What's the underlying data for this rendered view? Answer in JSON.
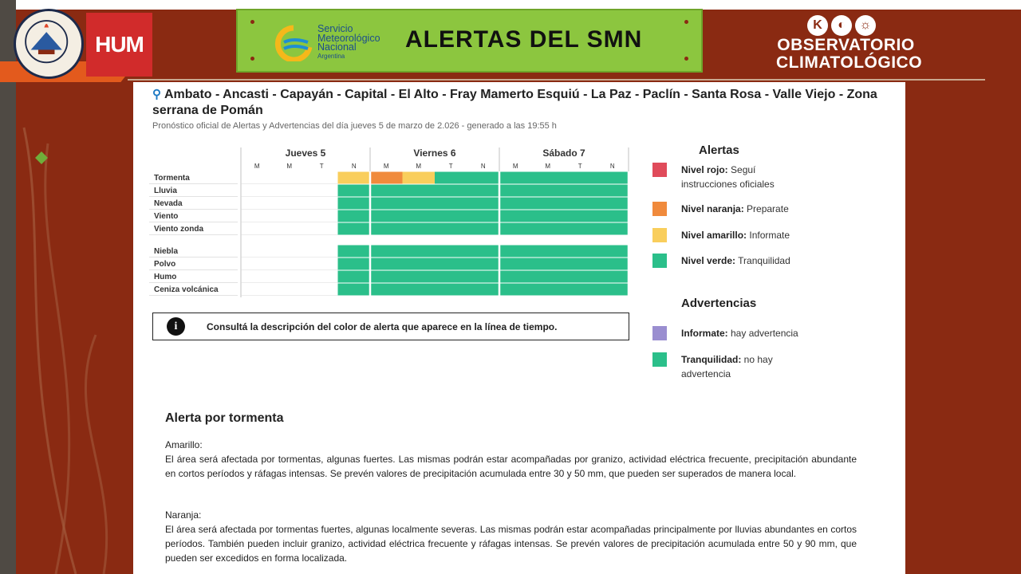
{
  "header": {
    "hum_label": "HUM",
    "smn_name_line1": "Servicio",
    "smn_name_line2": "Meteorológico",
    "smn_name_line3": "Nacional",
    "smn_name_line4": "Argentina",
    "title": "ALERTAS DEL SMN",
    "observatorio_line1": "OBSERVATORIO",
    "observatorio_line2": "CLIMATOLÓGICO"
  },
  "location": {
    "places": "Ambato - Ancasti - Capayán - Capital - El Alto - Fray Mamerto Esquiú - La Paz - Paclín - Santa Rosa - Valle Viejo - Zona serrana de Pomán",
    "subtitle": "Pronóstico oficial de Alertas y Advertencias del día jueves 5 de marzo de 2.026 - generado a las 19:55 h"
  },
  "timeline": {
    "days": [
      "Jueves 5",
      "Viernes 6",
      "Sábado 7"
    ],
    "slots": [
      "M",
      "M",
      "T",
      "N"
    ],
    "phenomena": [
      {
        "name": "Tormenta",
        "levels": [
          null,
          null,
          null,
          "amarillo",
          "naranja",
          "amarillo",
          "verde",
          "verde",
          "verde",
          "verde",
          "verde",
          "verde"
        ]
      },
      {
        "name": "Lluvia",
        "levels": [
          null,
          null,
          null,
          "verde",
          "verde",
          "verde",
          "verde",
          "verde",
          "verde",
          "verde",
          "verde",
          "verde"
        ]
      },
      {
        "name": "Nevada",
        "levels": [
          null,
          null,
          null,
          "verde",
          "verde",
          "verde",
          "verde",
          "verde",
          "verde",
          "verde",
          "verde",
          "verde"
        ]
      },
      {
        "name": "Viento",
        "levels": [
          null,
          null,
          null,
          "verde",
          "verde",
          "verde",
          "verde",
          "verde",
          "verde",
          "verde",
          "verde",
          "verde"
        ]
      },
      {
        "name": "Viento zonda",
        "levels": [
          null,
          null,
          null,
          "verde",
          "verde",
          "verde",
          "verde",
          "verde",
          "verde",
          "verde",
          "verde",
          "verde"
        ]
      },
      {
        "name": "Niebla",
        "levels": [
          null,
          null,
          null,
          "verde",
          "verde",
          "verde",
          "verde",
          "verde",
          "verde",
          "verde",
          "verde",
          "verde"
        ]
      },
      {
        "name": "Polvo",
        "levels": [
          null,
          null,
          null,
          "verde",
          "verde",
          "verde",
          "verde",
          "verde",
          "verde",
          "verde",
          "verde",
          "verde"
        ]
      },
      {
        "name": "Humo",
        "levels": [
          null,
          null,
          null,
          "verde",
          "verde",
          "verde",
          "verde",
          "verde",
          "verde",
          "verde",
          "verde",
          "verde"
        ]
      },
      {
        "name": "Ceniza volcánica",
        "levels": [
          null,
          null,
          null,
          "verde",
          "verde",
          "verde",
          "verde",
          "verde",
          "verde",
          "verde",
          "verde",
          "verde"
        ]
      }
    ],
    "colors": {
      "rojo": "#e04b5a",
      "naranja": "#f08a3c",
      "amarillo": "#f9ce5c",
      "verde": "#2bbf8a",
      "violeta": "#9a8ed0"
    }
  },
  "info_note": "Consultá la descripción del color de alerta que aparece en la línea de tiempo.",
  "legend": {
    "alertas_title": "Alertas",
    "alertas": [
      {
        "label": "Nivel rojo:",
        "desc": "Seguí instrucciones oficiales",
        "color": "#e04b5a"
      },
      {
        "label": "Nivel naranja:",
        "desc": "Preparate",
        "color": "#f08a3c"
      },
      {
        "label": "Nivel amarillo:",
        "desc": "Informate",
        "color": "#f9ce5c"
      },
      {
        "label": "Nivel verde:",
        "desc": "Tranquilidad",
        "color": "#2bbf8a"
      }
    ],
    "advertencias_title": "Advertencias",
    "advertencias": [
      {
        "label": "Informate:",
        "desc": "hay advertencia",
        "color": "#9a8ed0"
      },
      {
        "label": "Tranquilidad:",
        "desc": "no hay advertencia",
        "color": "#2bbf8a"
      }
    ]
  },
  "detail": {
    "title": "Alerta por tormenta",
    "amarillo_heading": "Amarillo:",
    "amarillo_text": "El área será afectada por tormentas, algunas fuertes. Las mismas podrán estar acompañadas por granizo, actividad eléctrica frecuente, precipitación abundante en cortos períodos y ráfagas intensas. Se prevén valores de precipitación acumulada entre 30 y 50 mm, que pueden ser superados de manera local.",
    "naranja_heading": "Naranja:",
    "naranja_text": "El área será afectada por tormentas fuertes, algunas localmente severas. Las mismas podrán estar acompañadas principalmente por lluvias abundantes en cortos períodos. También pueden incluir granizo, actividad eléctrica frecuente y ráfagas intensas. Se prevén valores de precipitación acumulada entre 50 y 90 mm, que pueden ser excedidos en forma localizada."
  }
}
